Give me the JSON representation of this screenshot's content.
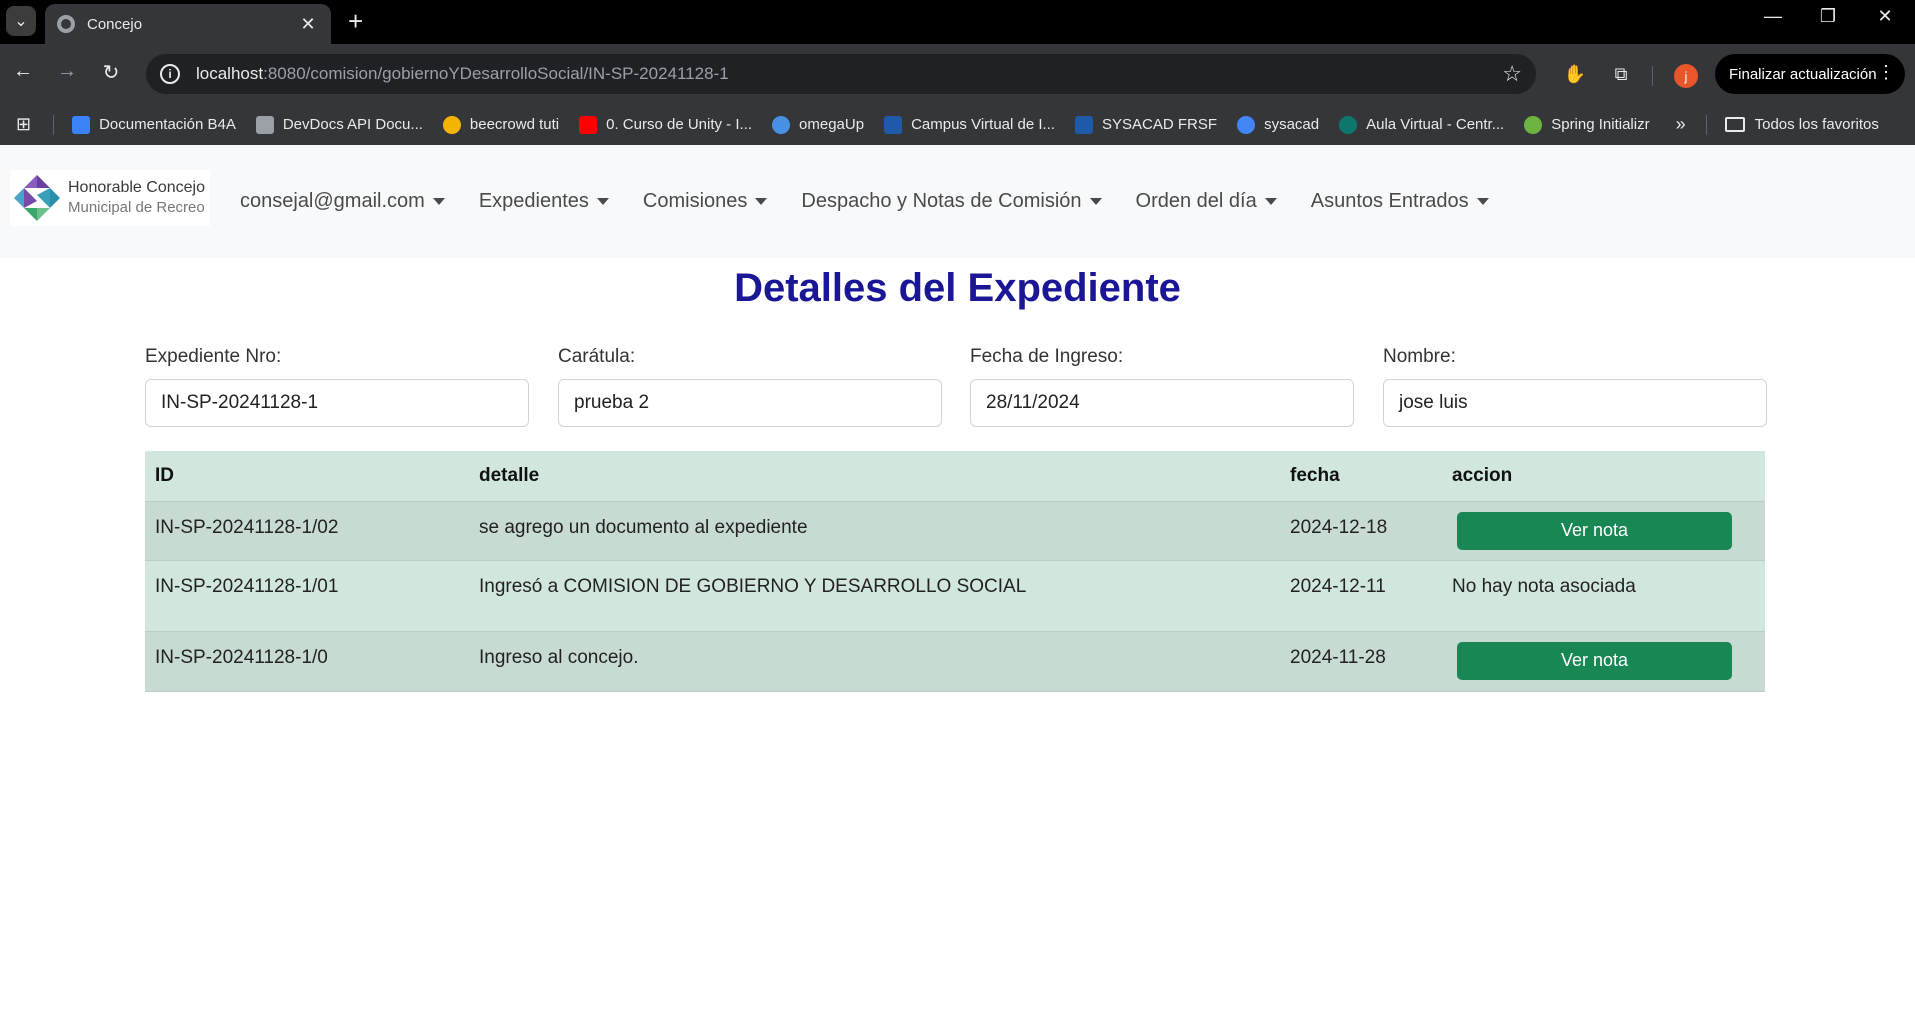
{
  "browser": {
    "tab_title": "Concejo",
    "url_host": "localhost",
    "url_path": ":8080/comision/gobiernoYDesarrolloSocial/IN-SP-20241128-1",
    "profile_initial": "j",
    "update_button": "Finalizar actualización",
    "bookmarks": [
      {
        "label": "Documentación B4A",
        "color": "#3b82f6"
      },
      {
        "label": "DevDocs API Docu...",
        "color": "#9aa0a6"
      },
      {
        "label": "beecrowd tuti",
        "color": "#f5b400"
      },
      {
        "label": "0. Curso de Unity - I...",
        "color": "#ff0000"
      },
      {
        "label": "omegaUp",
        "color": "#4a90e2"
      },
      {
        "label": "Campus Virtual de I...",
        "color": "#1e5aa8"
      },
      {
        "label": "SYSACAD FRSF",
        "color": "#1e5aa8"
      },
      {
        "label": "sysacad",
        "color": "#4285f4"
      },
      {
        "label": "Aula Virtual - Centr...",
        "color": "#0f766e"
      },
      {
        "label": "Spring Initializr",
        "color": "#6db33f"
      }
    ],
    "bookmarks_folder": "Todos los favoritos"
  },
  "brand": {
    "line1": "Honorable Concejo",
    "line2": "Municipal de Recreo"
  },
  "nav": {
    "user": "consejal@gmail.com",
    "expedientes": "Expedientes",
    "comisiones": "Comisiones",
    "despacho": "Despacho y Notas de Comisión",
    "orden": "Orden del día",
    "asuntos": "Asuntos Entrados"
  },
  "page": {
    "title": "Detalles del Expediente"
  },
  "fields": {
    "nro_label": "Expediente Nro:",
    "nro_value": "IN-SP-20241128-1",
    "caratula_label": "Carátula:",
    "caratula_value": "prueba 2",
    "fecha_label": "Fecha de Ingreso:",
    "fecha_value": "28/11/2024",
    "nombre_label": "Nombre:",
    "nombre_value": "jose luis"
  },
  "table": {
    "headers": {
      "id": "ID",
      "detalle": "detalle",
      "fecha": "fecha",
      "accion": "accion"
    },
    "rows": [
      {
        "id": "IN-SP-20241128-1/02",
        "detalle": "se agrego un documento al expediente",
        "fecha": "2024-12-18",
        "accion": "Ver nota"
      },
      {
        "id": "IN-SP-20241128-1/01",
        "detalle": "Ingresó a COMISION DE GOBIERNO Y DESARROLLO SOCIAL",
        "fecha": "2024-12-11",
        "accion": "No hay nota asociada"
      },
      {
        "id": "IN-SP-20241128-1/0",
        "detalle": "Ingreso al concejo.",
        "fecha": "2024-11-28",
        "accion": "Ver nota"
      }
    ]
  },
  "colors": {
    "title": "#1a1696",
    "button": "#198754",
    "table_bg": "#d1e7dd"
  }
}
